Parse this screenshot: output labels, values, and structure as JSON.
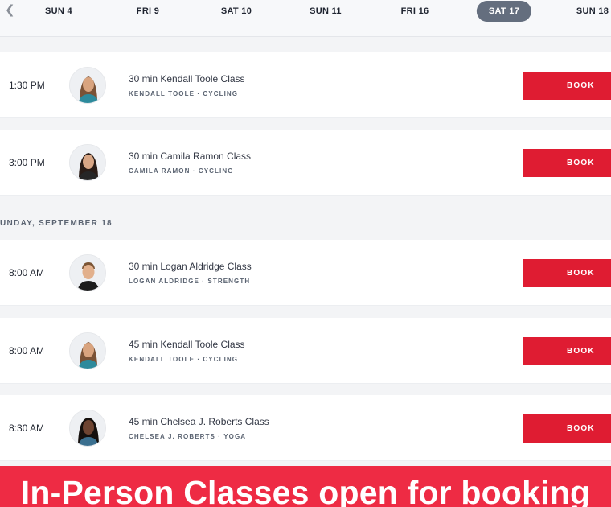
{
  "date_nav": {
    "back_icon": "chevron-left-icon",
    "days": [
      "SUN 4",
      "FRI 9",
      "SAT 10",
      "SUN 11",
      "FRI 16",
      "SAT 17",
      "SUN 18"
    ],
    "selected": "SAT 17"
  },
  "section_label": "UNDAY, SEPTEMBER 18",
  "classes": [
    {
      "time": "1:30 PM",
      "title": "30 min Kendall Toole Class",
      "meta": "KENDALL TOOLE · CYCLING",
      "book_label": "BOOK"
    },
    {
      "time": "3:00 PM",
      "title": "30 min Camila Ramon Class",
      "meta": "CAMILA RAMON · CYCLING",
      "book_label": "BOOK"
    },
    {
      "time": "8:00 AM",
      "title": "30 min Logan Aldridge Class",
      "meta": "LOGAN ALDRIDGE · STRENGTH",
      "book_label": "BOOK"
    },
    {
      "time": "8:00 AM",
      "title": "45 min Kendall Toole Class",
      "meta": "KENDALL TOOLE · CYCLING",
      "book_label": "BOOK"
    },
    {
      "time": "8:30 AM",
      "title": "45 min Chelsea J. Roberts Class",
      "meta": "CHELSEA J. ROBERTS · YOGA",
      "book_label": "BOOK"
    }
  ],
  "banner_text": "In-Person Classes open for booking",
  "colors": {
    "accent": "#df1c32",
    "banner": "#ee2b44",
    "selected_day": "#646e7e"
  }
}
